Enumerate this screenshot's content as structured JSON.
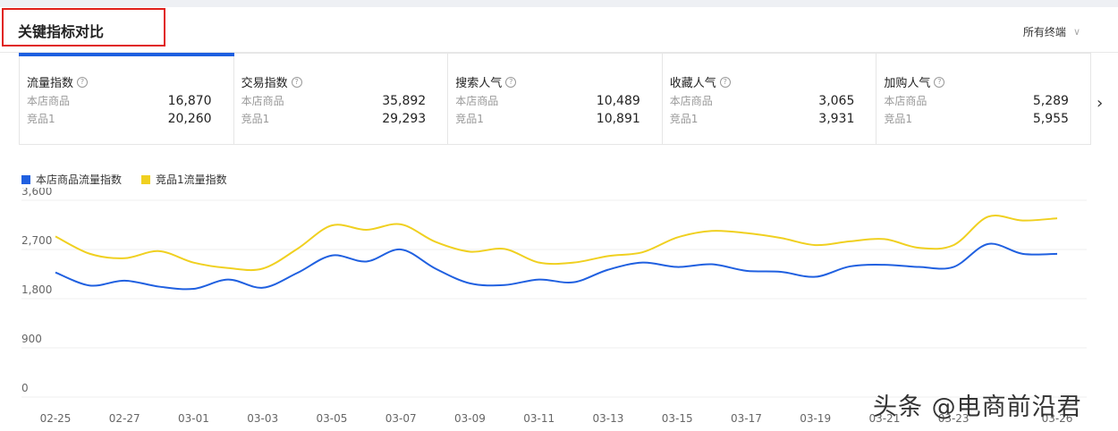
{
  "header": {
    "title": "关键指标对比",
    "terminal_label": "所有终端"
  },
  "cards": [
    {
      "title": "流量指数",
      "rows": [
        {
          "label": "本店商品",
          "value": "16,870"
        },
        {
          "label": "竞品1",
          "value": "20,260"
        }
      ]
    },
    {
      "title": "交易指数",
      "rows": [
        {
          "label": "本店商品",
          "value": "35,892"
        },
        {
          "label": "竞品1",
          "value": "29,293"
        }
      ]
    },
    {
      "title": "搜索人气",
      "rows": [
        {
          "label": "本店商品",
          "value": "10,489"
        },
        {
          "label": "竞品1",
          "value": "10,891"
        }
      ]
    },
    {
      "title": "收藏人气",
      "rows": [
        {
          "label": "本店商品",
          "value": "3,065"
        },
        {
          "label": "竞品1",
          "value": "3,931"
        }
      ]
    },
    {
      "title": "加购人气",
      "rows": [
        {
          "label": "本店商品",
          "value": "5,289"
        },
        {
          "label": "竞品1",
          "value": "5,955"
        }
      ]
    }
  ],
  "legend": [
    {
      "label": "本店商品流量指数",
      "color": "#2060e0"
    },
    {
      "label": "竞品1流量指数",
      "color": "#f0d020"
    }
  ],
  "watermark": "头条 @电商前沿君",
  "chart_data": {
    "type": "line",
    "x": [
      "02-25",
      "02-26",
      "02-27",
      "02-28",
      "03-01",
      "03-02",
      "03-03",
      "03-04",
      "03-05",
      "03-06",
      "03-07",
      "03-08",
      "03-09",
      "03-10",
      "03-11",
      "03-12",
      "03-13",
      "03-14",
      "03-15",
      "03-16",
      "03-17",
      "03-18",
      "03-19",
      "03-20",
      "03-21",
      "03-22",
      "03-23",
      "03-24",
      "03-25",
      "03-26"
    ],
    "x_ticks": [
      "02-25",
      "02-27",
      "03-01",
      "03-03",
      "03-05",
      "03-07",
      "03-09",
      "03-11",
      "03-13",
      "03-15",
      "03-17",
      "03-19",
      "03-21",
      "03-23",
      "03-26"
    ],
    "y_ticks": [
      "3,600",
      "2,700",
      "1,800",
      "900",
      "0"
    ],
    "ylim": [
      0,
      3600
    ],
    "series": [
      {
        "name": "本店商品流量指数",
        "color": "#2060e0",
        "values": [
          2280,
          2040,
          2130,
          2020,
          1980,
          2150,
          2000,
          2270,
          2590,
          2480,
          2700,
          2350,
          2080,
          2050,
          2150,
          2100,
          2330,
          2460,
          2380,
          2430,
          2310,
          2290,
          2200,
          2390,
          2420,
          2380,
          2380,
          2800,
          2620,
          2620
        ]
      },
      {
        "name": "竞品1流量指数",
        "color": "#f0d020",
        "values": [
          2940,
          2620,
          2540,
          2670,
          2460,
          2360,
          2350,
          2710,
          3140,
          3060,
          3160,
          2840,
          2660,
          2710,
          2460,
          2460,
          2580,
          2650,
          2920,
          3040,
          3000,
          2910,
          2780,
          2850,
          2890,
          2730,
          2780,
          3300,
          3230,
          3270
        ]
      }
    ]
  }
}
